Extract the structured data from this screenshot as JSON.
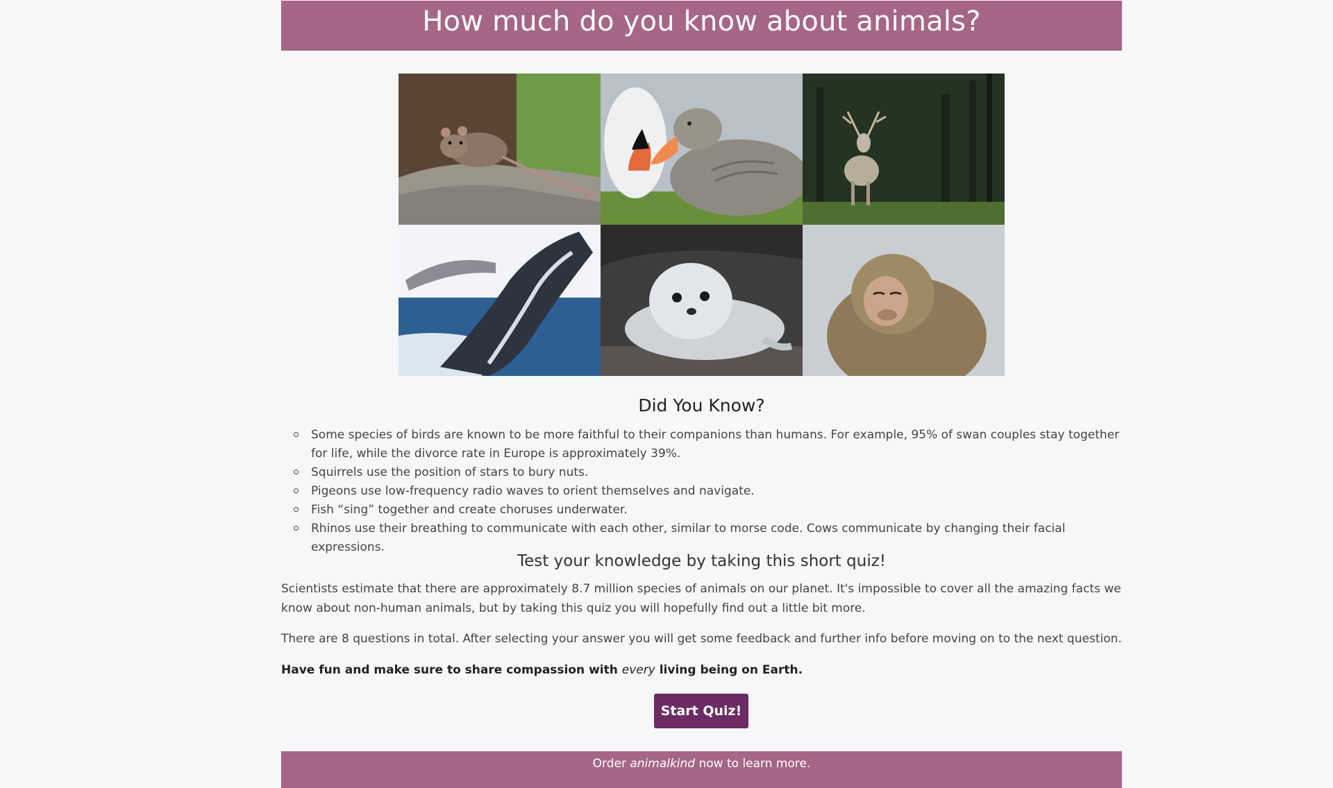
{
  "header": {
    "title": "How much do you know about animals?"
  },
  "gallery": {
    "images": [
      {
        "icon": "rat-photo"
      },
      {
        "icon": "geese-photo"
      },
      {
        "icon": "deer-photo"
      },
      {
        "icon": "whale-photo"
      },
      {
        "icon": "seal-photo"
      },
      {
        "icon": "monkey-photo"
      }
    ]
  },
  "facts_section": {
    "title": "Did You Know?",
    "items": [
      "Some species of birds are known to be more faithful to their companions than humans. For example, 95% of swan couples stay together for life, while the divorce rate in Europe is approximately 39%.",
      "Squirrels use the position of stars to bury nuts.",
      "Pigeons use low-frequency radio waves to orient themselves and navigate.",
      "Fish “sing” together and create choruses underwater.",
      "Rhinos use their breathing to communicate with each other, similar to morse code. Cows communicate by changing their facial expressions."
    ]
  },
  "quiz_intro": {
    "title": "Test your knowledge by taking this short quiz!",
    "paragraph1": "Scientists estimate that there are approximately 8.7 million species of animals on our planet. It's impossible to cover all the amazing facts we know about non-human animals, but by taking this quiz you will hopefully find out a little bit more.",
    "paragraph2": "There are 8 questions in total. After selecting your answer you will get some feedback and further info before moving on to the next question.",
    "closing_before": "Have fun and make sure to share compassion with ",
    "closing_em": "every",
    "closing_after": " living being on Earth."
  },
  "start_button": {
    "label": "Start Quiz!"
  },
  "footer": {
    "text_before": "Order ",
    "text_em": "animalkind",
    "text_after": " now to learn more."
  },
  "colors": {
    "header_bg": "#a56688",
    "button_bg": "#6a2c63",
    "page_bg": "#f6f7f8"
  }
}
